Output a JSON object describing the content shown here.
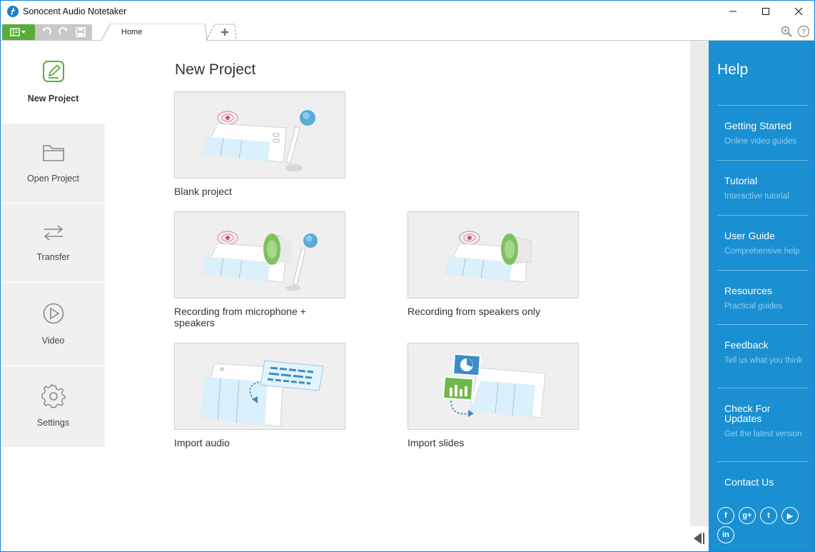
{
  "app": {
    "title": "Sonocent Audio Notetaker"
  },
  "tabs": [
    {
      "label": "Home"
    }
  ],
  "nav": {
    "items": [
      {
        "label": "New Project",
        "icon": "pencil-square-icon"
      },
      {
        "label": "Open Project",
        "icon": "folder-icon"
      },
      {
        "label": "Transfer",
        "icon": "transfer-arrows-icon"
      },
      {
        "label": "Video",
        "icon": "play-circle-icon"
      },
      {
        "label": "Settings",
        "icon": "gear-icon"
      }
    ]
  },
  "main": {
    "title": "New Project",
    "cards": [
      {
        "label": "Blank project"
      },
      {
        "label": "Recording from microphone + speakers"
      },
      {
        "label": "Recording from speakers only"
      },
      {
        "label": "Import audio"
      },
      {
        "label": "Import slides"
      }
    ]
  },
  "help": {
    "title": "Help",
    "items": [
      {
        "title": "Getting Started",
        "subtitle": "Online video guides"
      },
      {
        "title": "Tutorial",
        "subtitle": "Interactive tutorial"
      },
      {
        "title": "User Guide",
        "subtitle": "Comprehensive help"
      },
      {
        "title": "Resources",
        "subtitle": "Practical guides"
      },
      {
        "title": "Feedback",
        "subtitle": "Tell us what you think"
      },
      {
        "title": "Check For Updates",
        "subtitle": "Get the latest version"
      },
      {
        "title": "Contact Us",
        "subtitle": ""
      }
    ],
    "social": [
      {
        "icon": "facebook-icon",
        "glyph": "f"
      },
      {
        "icon": "google-plus-icon",
        "glyph": "g+"
      },
      {
        "icon": "twitter-icon",
        "glyph": "t"
      },
      {
        "icon": "youtube-icon",
        "glyph": "▶"
      },
      {
        "icon": "linkedin-icon",
        "glyph": "in"
      }
    ]
  },
  "colors": {
    "accent_blue": "#1a8fd1",
    "menu_green": "#5aab3a",
    "nav_bg": "#f0f0f0"
  }
}
